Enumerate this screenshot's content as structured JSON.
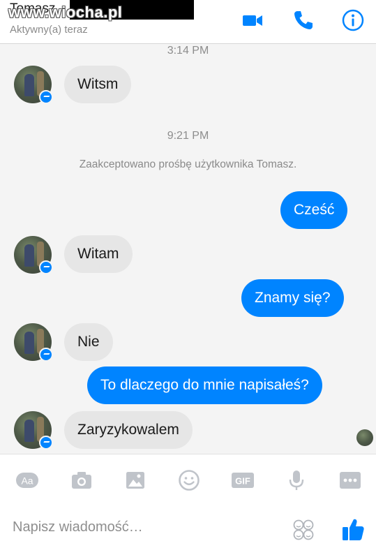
{
  "header": {
    "contact_name": "Tomasz",
    "status": "Aktywny(a) teraz",
    "watermark": "www.wiocha.pl"
  },
  "colors": {
    "accent": "#0084ff",
    "incoming_bubble": "#e6e6e6",
    "background": "#f4f4f4"
  },
  "conversation": {
    "time_1": "3:14 PM",
    "time_2": "9:21 PM",
    "system_message": "Zaakceptowano prośbę użytkownika Tomasz.",
    "messages": [
      {
        "from": "them",
        "text": "Witsm"
      },
      {
        "from": "me",
        "text": "Cześć"
      },
      {
        "from": "them",
        "text": "Witam"
      },
      {
        "from": "me",
        "text": "Znamy się?"
      },
      {
        "from": "them",
        "text": "Nie"
      },
      {
        "from": "me",
        "text": "To dlaczego do mnie napisałeś?"
      },
      {
        "from": "them",
        "text": "Zaryzykowalem"
      }
    ]
  },
  "toolbar": {
    "text_icon_label": "Aa",
    "gif_label": "GIF",
    "icons": [
      "text-format-icon",
      "camera-icon",
      "gallery-icon",
      "emoji-icon",
      "gif-icon",
      "microphone-icon",
      "more-icon"
    ]
  },
  "composer": {
    "placeholder": "Napisz wiadomość…"
  }
}
